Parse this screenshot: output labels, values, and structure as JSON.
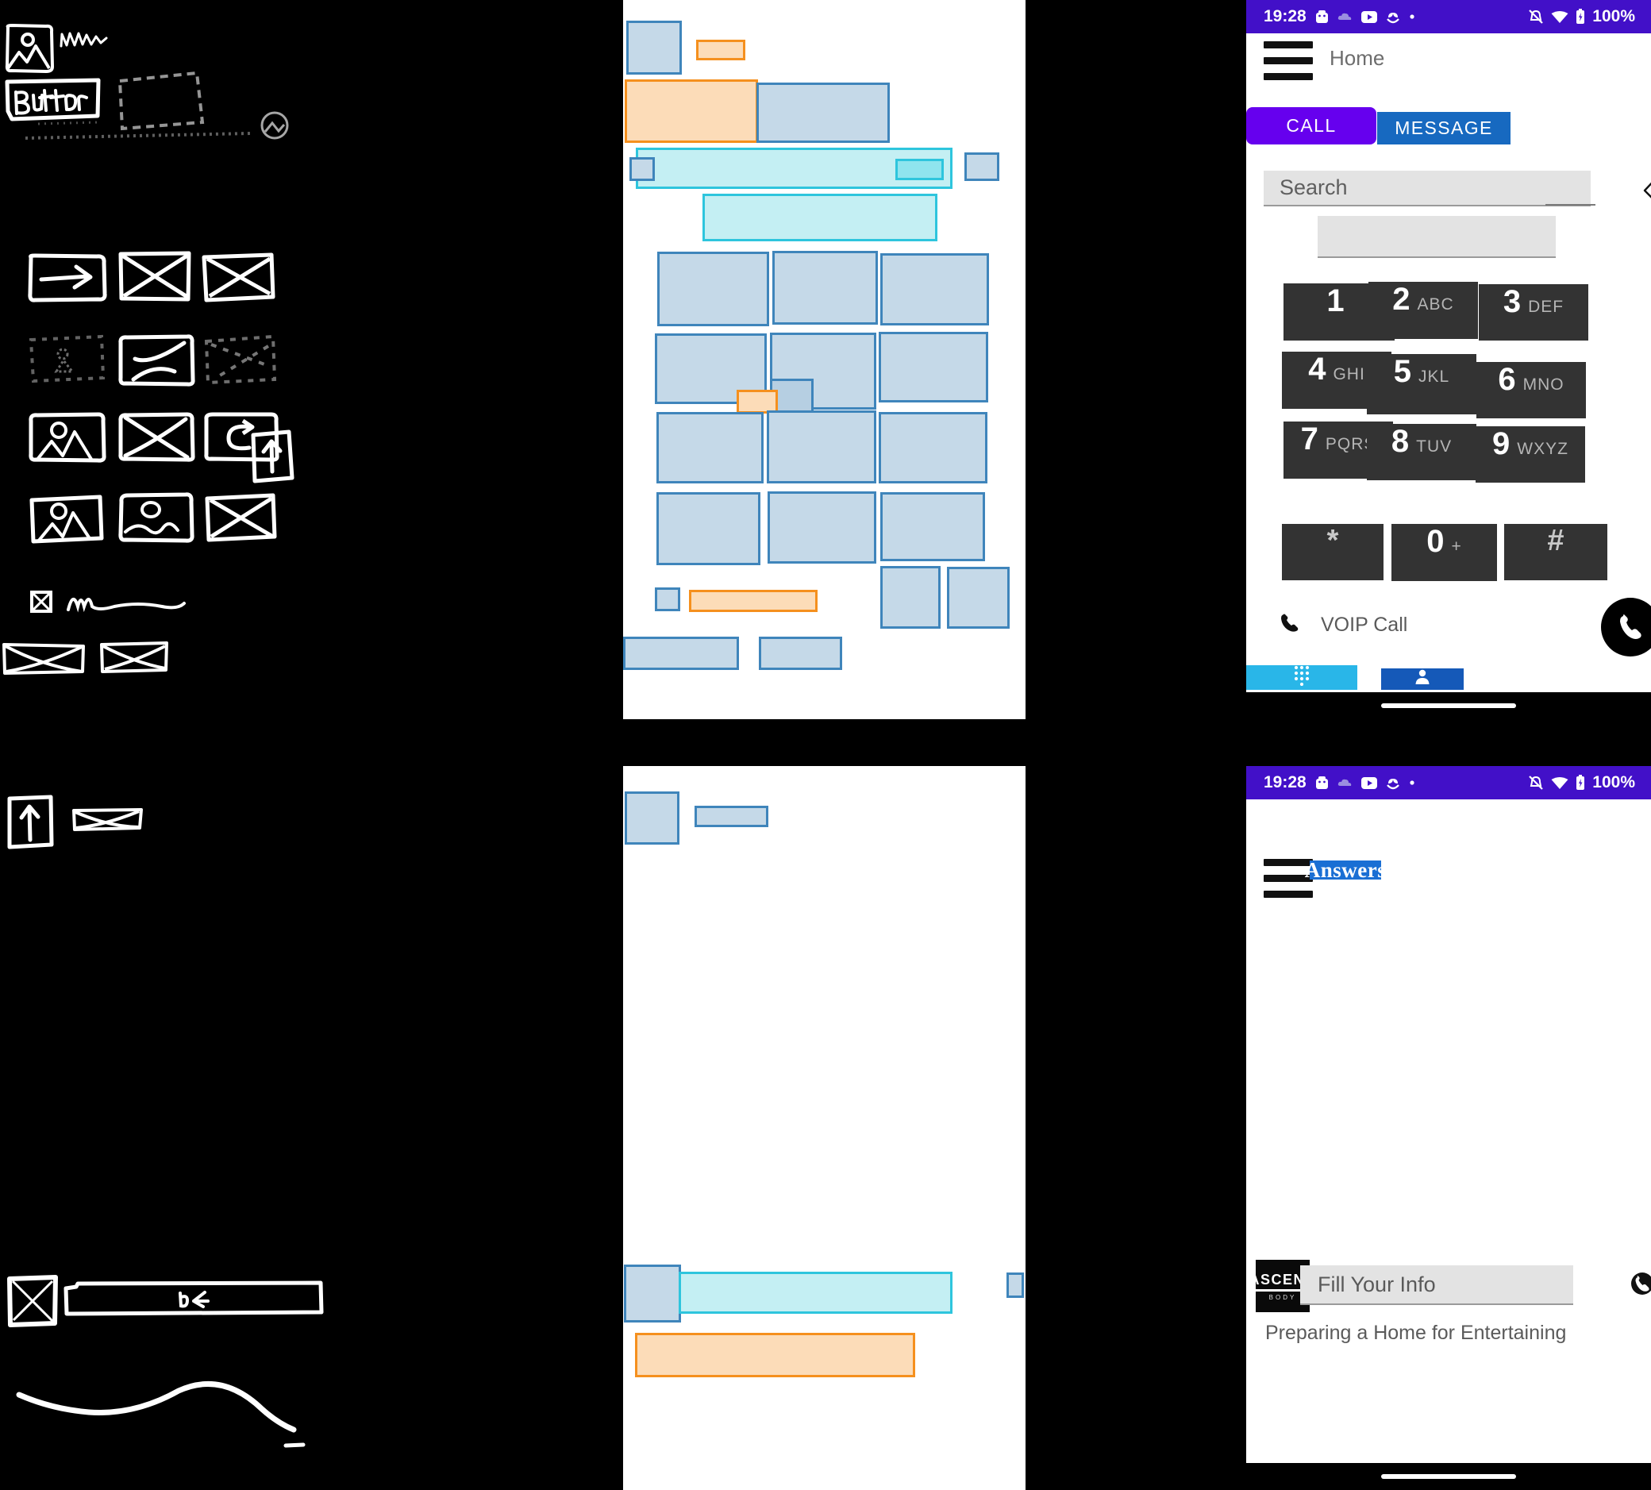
{
  "layout": {
    "columns": [
      "sketch",
      "wireframe",
      "screenshot"
    ],
    "rows": 2,
    "background_color": "#000000"
  },
  "palette": {
    "wire_blue_fill": "#c5d9e8",
    "wire_blue_stroke": "#3f85bb",
    "wire_orange_fill": "#fcdcb8",
    "wire_orange_stroke": "#f5901e",
    "wire_cyan_fill": "#c4eff3",
    "wire_cyan_stroke": "#2ec5dd",
    "status_bar_purple": "#4210c8",
    "call_tab_purple": "#6600ee",
    "message_tab_blue": "#1769c0",
    "key_dark": "#333333",
    "dial_tab_cyan": "#29b6e8",
    "contacts_tab_blue": "#1559b8",
    "answers_blue": "#1a6fd4"
  },
  "phone_dialer": {
    "status_bar": {
      "time": "19:28",
      "battery": "100%",
      "icons_left": [
        "android-icon",
        "cloud-icon",
        "youtube-icon",
        "sprout-icon",
        "dot-icon"
      ],
      "icons_right": [
        "alarm-off-icon",
        "wifi-icon",
        "battery-icon"
      ]
    },
    "app_bar": {
      "menu_icon": "hamburger-icon",
      "title": "Home"
    },
    "tabs": [
      {
        "label": "CALL",
        "active": true
      },
      {
        "label": "MESSAGE",
        "active": false
      }
    ],
    "search": {
      "placeholder": "Search",
      "value": "",
      "backspace_icon": "backspace-icon"
    },
    "keypad": [
      {
        "digit": "1",
        "letters": ""
      },
      {
        "digit": "2",
        "letters": "ABC"
      },
      {
        "digit": "3",
        "letters": "DEF"
      },
      {
        "digit": "4",
        "letters": "GHI"
      },
      {
        "digit": "5",
        "letters": "JKL"
      },
      {
        "digit": "6",
        "letters": "MNO"
      },
      {
        "digit": "7",
        "letters": "PQRS"
      },
      {
        "digit": "8",
        "letters": "TUV"
      },
      {
        "digit": "9",
        "letters": "WXYZ"
      },
      {
        "digit": "*",
        "letters": ""
      },
      {
        "digit": "0",
        "letters": "+"
      },
      {
        "digit": "#",
        "letters": ""
      }
    ],
    "voip": {
      "icon": "phone-handset-icon",
      "label": "VOIP Call"
    },
    "fab": {
      "icon": "phone-call-icon"
    },
    "bottom_tabs": [
      {
        "icon": "dialpad-icon",
        "active": true
      },
      {
        "icon": "contacts-person-icon",
        "active": false
      }
    ]
  },
  "phone_answers": {
    "status_bar": {
      "time": "19:28",
      "battery": "100%"
    },
    "app_bar": {
      "menu_icon": "hamburger-icon",
      "logo_text": "Answers"
    },
    "footer": {
      "brand_logo_line1": "ASCEND",
      "brand_logo_line2": "BODY",
      "field_placeholder": "Fill Your Info",
      "field_value": "",
      "phone_icon": "phone-circle-icon",
      "article_title": "Preparing a Home for Entertaining"
    }
  },
  "sketch_top": {
    "elements": [
      "image-placeholder-icon",
      "scribble-text",
      "button-box",
      "button-label",
      "faint-box",
      "faint-circle",
      "faint-underline",
      "arrow-right-box",
      "crossed-box",
      "crossed-box",
      "faint-person-box",
      "crossed-box",
      "faint-crossed-box",
      "image-circle-mountain-box",
      "crossed-box",
      "refresh-arrow-box",
      "image-circle-mountain-box",
      "image-oval-wave-box",
      "crossed-box",
      "small-crossed-square",
      "squiggle-line",
      "upload-arrow-box",
      "wide-crossed-box",
      "wide-crossed-box"
    ],
    "labels": {
      "button_text": "Button"
    }
  },
  "sketch_bottom": {
    "elements": [
      "upload-arrow-box",
      "crossed-box",
      "small-crossed-square",
      "long-bar-box",
      "scribble-in-bar",
      "wave-curve"
    ],
    "labels": {
      "bar_text": "bt"
    }
  },
  "wireframe_top": {
    "boxes_count": 26,
    "description": "detected UI element bounding boxes over a white page"
  },
  "wireframe_bottom": {
    "boxes_count": 7,
    "description": "detected UI element bounding boxes over a white page"
  }
}
